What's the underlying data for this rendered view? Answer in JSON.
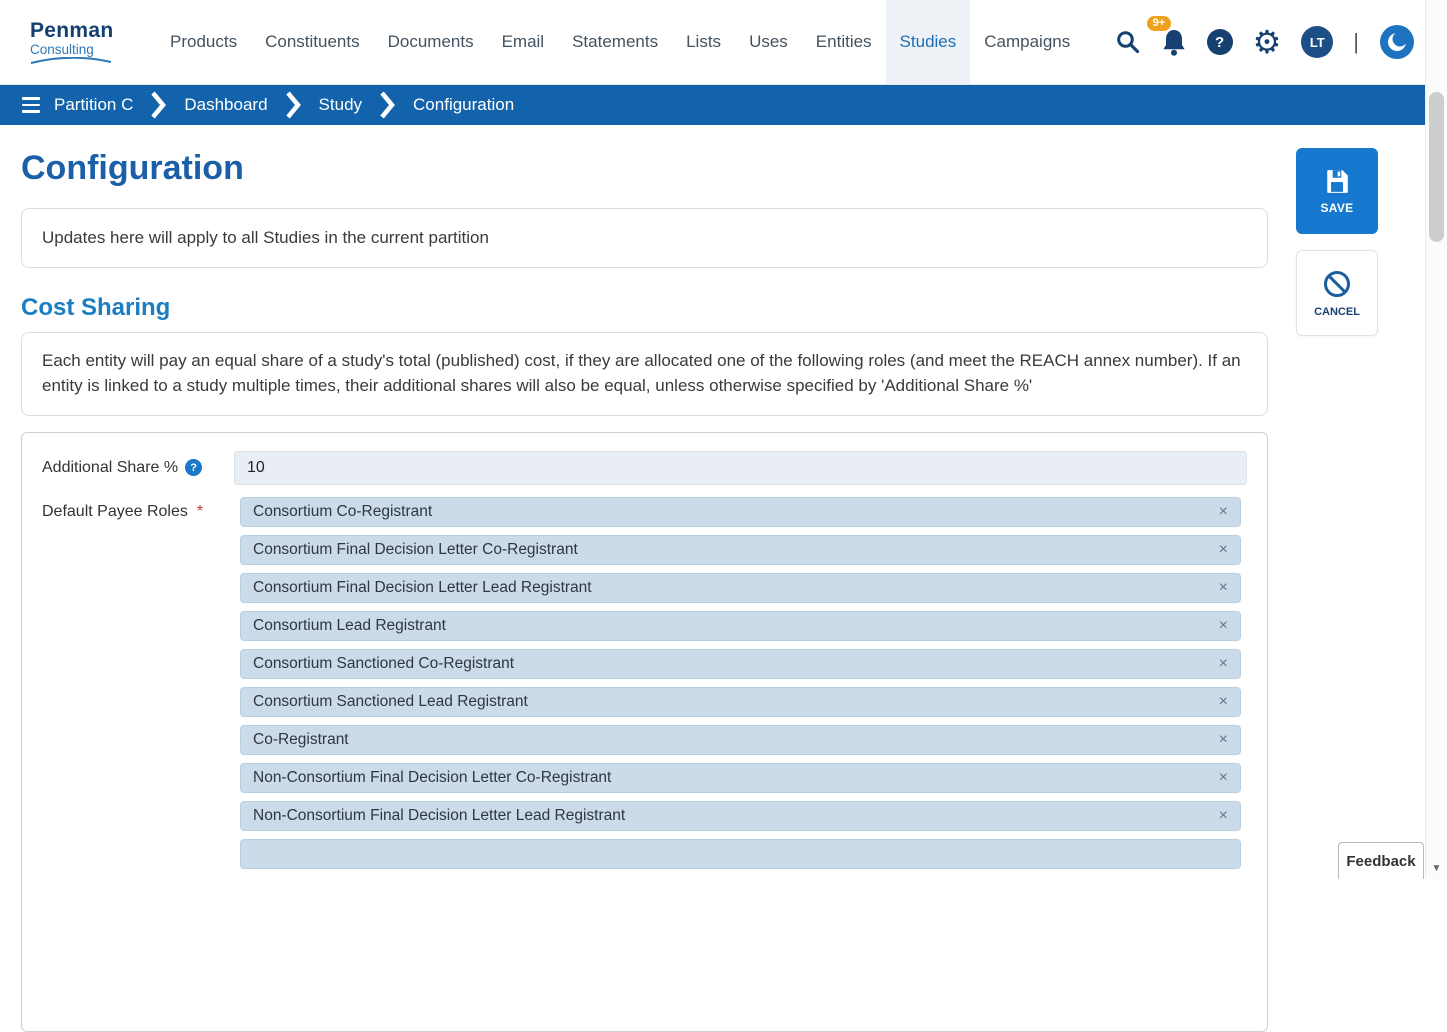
{
  "brand": {
    "name_top": "Penman",
    "name_bottom": "Consulting"
  },
  "nav": {
    "items": [
      {
        "label": "Products"
      },
      {
        "label": "Constituents"
      },
      {
        "label": "Documents"
      },
      {
        "label": "Email"
      },
      {
        "label": "Statements"
      },
      {
        "label": "Lists"
      },
      {
        "label": "Uses"
      },
      {
        "label": "Entities"
      },
      {
        "label": "Studies",
        "active": true
      },
      {
        "label": "Campaigns"
      }
    ],
    "notification_badge": "9+",
    "avatar_initials": "LT",
    "separator": "|"
  },
  "breadcrumb": {
    "items": [
      {
        "label": "Partition C"
      },
      {
        "label": "Dashboard"
      },
      {
        "label": "Study"
      },
      {
        "label": "Configuration"
      }
    ]
  },
  "page": {
    "title": "Configuration",
    "notice": "Updates here will apply to all Studies in the current partition",
    "section": {
      "title": "Cost Sharing",
      "description": "Each entity will pay an equal share of a study's total (published) cost, if they are allocated one of the following roles (and meet the REACH annex number). If an entity is linked to a study multiple times, their additional shares will also be equal, unless otherwise specified by 'Additional Share %'"
    }
  },
  "actions": {
    "save": "SAVE",
    "cancel": "CANCEL"
  },
  "form": {
    "additional_share": {
      "label": "Additional Share %",
      "value": "10"
    },
    "payee_roles": {
      "label": "Default Payee Roles",
      "required": "*",
      "tags": [
        "Consortium Co-Registrant",
        "Consortium Final Decision Letter Co-Registrant",
        "Consortium Final Decision Letter Lead Registrant",
        "Consortium Lead Registrant",
        "Consortium Sanctioned Co-Registrant",
        "Consortium Sanctioned Lead Registrant",
        "Co-Registrant",
        "Non-Consortium Final Decision Letter Co-Registrant",
        "Non-Consortium Final Decision Letter Lead Registrant"
      ]
    }
  },
  "feedback": {
    "label": "Feedback"
  },
  "icons": {
    "help": "?",
    "gear": "⚙",
    "remove": "×",
    "scroll_down": "▼"
  },
  "colors": {
    "breadcrumb_blue": "#1263ab",
    "accent_blue": "#1778cf",
    "heading_blue": "#1b7ec2",
    "title_blue": "#1a5fa8",
    "badge_orange": "#f0a11c",
    "tag_bg": "#ccdbe9"
  }
}
